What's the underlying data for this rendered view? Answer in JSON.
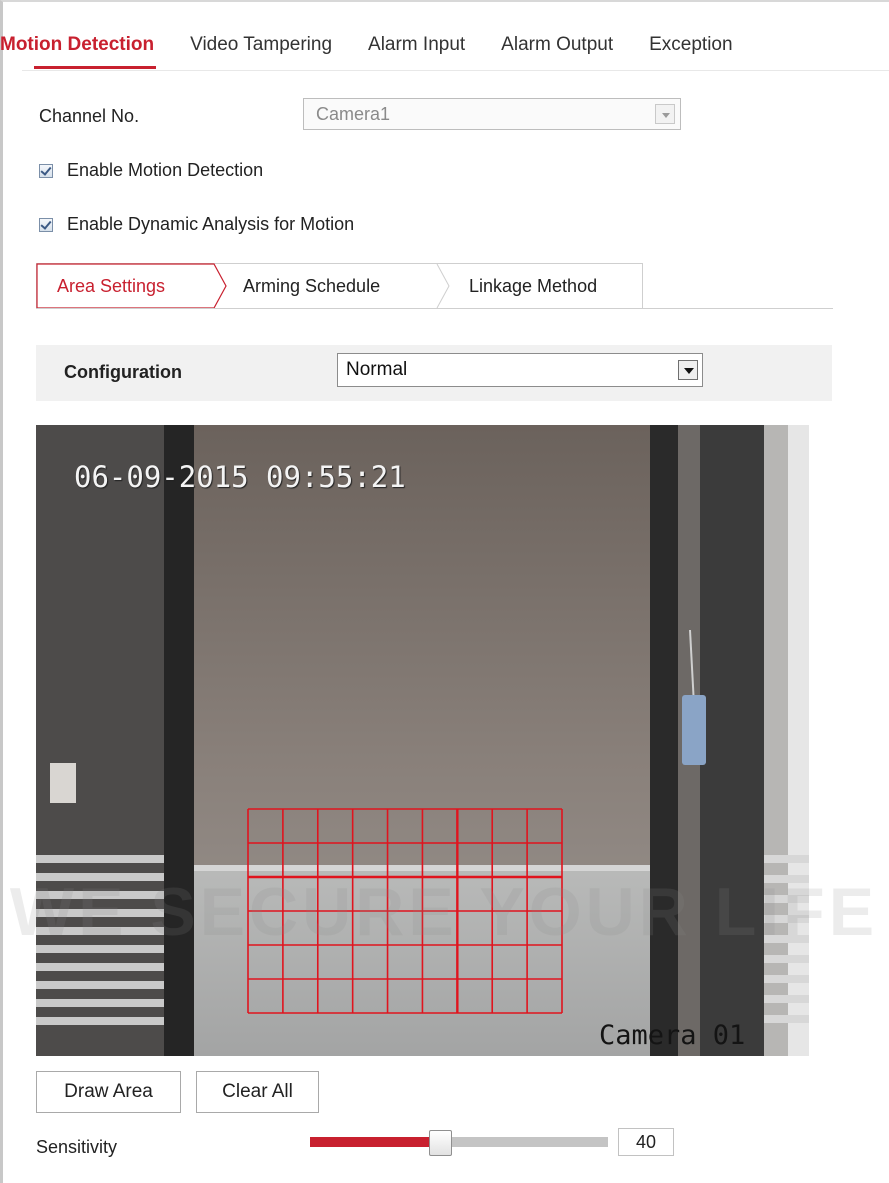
{
  "top_tabs": [
    {
      "label": "Motion Detection",
      "active": true
    },
    {
      "label": "Video Tampering",
      "active": false
    },
    {
      "label": "Alarm Input",
      "active": false
    },
    {
      "label": "Alarm Output",
      "active": false
    },
    {
      "label": "Exception",
      "active": false
    }
  ],
  "channel": {
    "label": "Channel No.",
    "value": "Camera1"
  },
  "enable_motion": {
    "label": "Enable Motion Detection",
    "checked": true
  },
  "enable_dynamic": {
    "label": "Enable Dynamic Analysis for Motion",
    "checked": true
  },
  "sub_tabs": [
    {
      "label": "Area Settings",
      "active": true
    },
    {
      "label": "Arming Schedule",
      "active": false
    },
    {
      "label": "Linkage Method",
      "active": false
    }
  ],
  "configuration": {
    "label": "Configuration",
    "value": "Normal"
  },
  "video": {
    "osd_time": "06-09-2015 09:55:21",
    "osd_camera": "Camera 01",
    "grid_rows": 6,
    "grid_cols": 9
  },
  "buttons": {
    "draw_area": "Draw Area",
    "clear_all": "Clear All"
  },
  "sensitivity": {
    "label": "Sensitivity",
    "value": "40",
    "fraction": 0.4
  },
  "watermark": {
    "text": "WE SECURE YOUR LIFE"
  },
  "colors": {
    "accent": "#c8202f",
    "grid": "#e0141e"
  }
}
